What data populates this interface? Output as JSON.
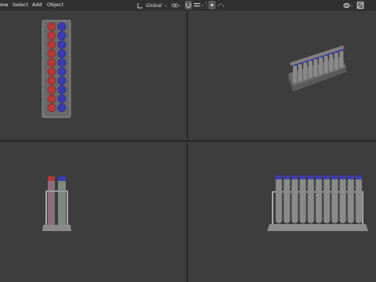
{
  "header": {
    "menus": [
      {
        "id": "view",
        "label": "View"
      },
      {
        "id": "select",
        "label": "Select"
      },
      {
        "id": "add",
        "label": "Add"
      },
      {
        "id": "object",
        "label": "Object"
      }
    ],
    "transform_orientation": "Global",
    "snap_icon": "magnet-icon",
    "pivot_icon": "link-icon",
    "proportional_icon": "circle-dot-icon",
    "overlay_icon": "overlay-icon",
    "xray_icon": "xray-icon"
  },
  "colors": {
    "background": "#3d3d3d",
    "header": "#303030",
    "tube_red": "#b03a3a",
    "tube_blue": "#3c3cb0",
    "rack_grey": "#7a7a7a",
    "tube_grey": "#8a8a8a"
  },
  "viewports": [
    {
      "id": "top-view",
      "label": "Top view"
    },
    {
      "id": "perspective-view",
      "label": "Perspective view"
    },
    {
      "id": "side-view",
      "label": "Side view"
    },
    {
      "id": "front-view",
      "label": "Front view"
    }
  ]
}
